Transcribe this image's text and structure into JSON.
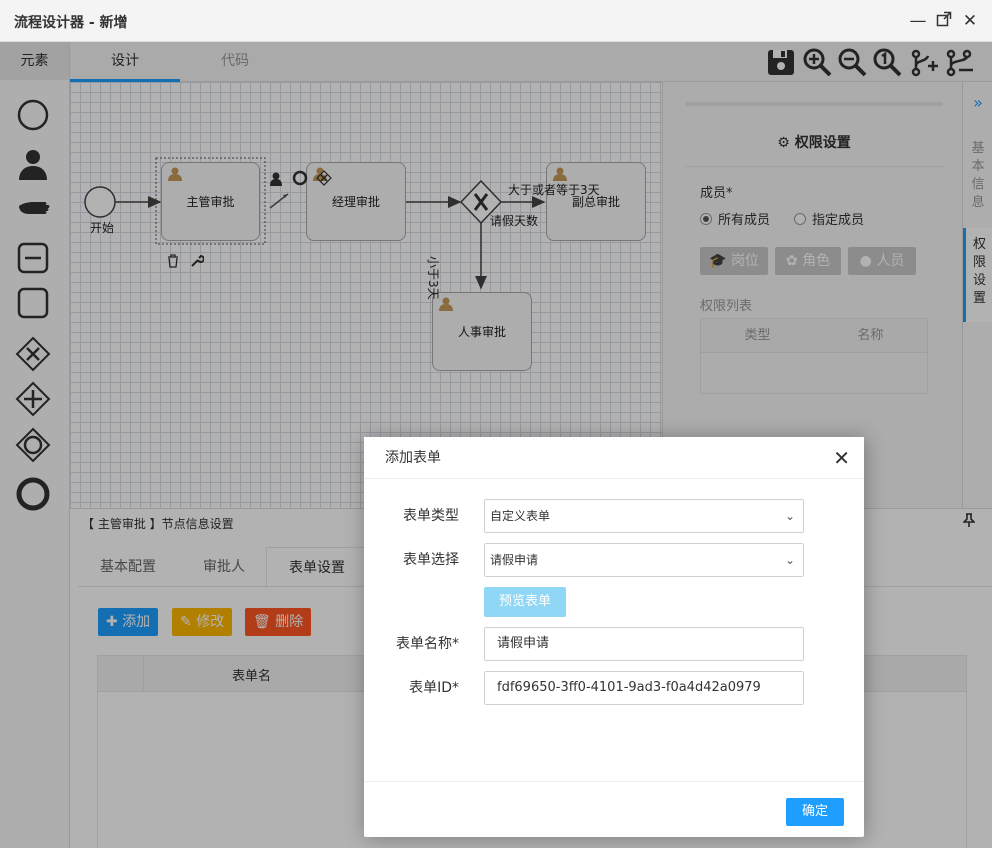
{
  "window": {
    "title": "流程设计器 - 新增",
    "minimize_icon": "minimize-icon",
    "maximize_icon": "maximize-icon",
    "close_icon": "close-icon"
  },
  "left_panel": {
    "title": "元素",
    "tools": [
      "start-event-icon",
      "user-task-icon",
      "manual-task-icon",
      "subprocess-collapsed-icon",
      "task-icon",
      "exclusive-gateway-icon",
      "parallel-gateway-icon",
      "inclusive-gateway-icon",
      "end-event-icon"
    ]
  },
  "tabs": [
    {
      "label": "设计",
      "active": true
    },
    {
      "label": "代码",
      "active": false
    }
  ],
  "toolbar_icons": [
    "save-icon",
    "zoom-in-icon",
    "zoom-out-icon",
    "actual-size-icon",
    "add-branch-icon",
    "branch-icon"
  ],
  "diagram": {
    "start_label": "开始",
    "nodes": {
      "supervisor": "主管审批",
      "manager": "经理审批",
      "vp": "副总审批",
      "hr": "人事审批"
    },
    "labels": {
      "gt3": "大于或者等于3天",
      "leave_days": "请假天数",
      "lt3": "小于3天"
    }
  },
  "right_panel": {
    "title": "权限设置",
    "members_label": "成员*",
    "options": [
      {
        "label": "所有成员",
        "selected": true
      },
      {
        "label": "指定成员",
        "selected": false
      }
    ],
    "buttons": [
      "岗位",
      "角色",
      "人员"
    ],
    "list_title": "权限列表",
    "columns": [
      "类型",
      "名称"
    ]
  },
  "right_strip": {
    "expand_icon": "double-chevron-right-icon",
    "tabs": [
      {
        "label": "基本信息",
        "active": false
      },
      {
        "label": "权限设置",
        "active": true
      }
    ]
  },
  "bottom_panel": {
    "title": "【 主管审批 】节点信息设置",
    "tabs": [
      {
        "label": "基本配置",
        "active": false
      },
      {
        "label": "审批人",
        "active": false
      },
      {
        "label": "表单设置",
        "active": true
      }
    ],
    "actions": {
      "add": "添加",
      "edit": "修改",
      "delete": "删除"
    },
    "table_columns": [
      "表单名"
    ]
  },
  "dialog": {
    "title": "添加表单",
    "fields": {
      "type_label": "表单类型",
      "type_value": "自定义表单",
      "select_label": "表单选择",
      "select_value": "请假申请",
      "preview_button": "预览表单",
      "name_label": "表单名称*",
      "name_value": "请假申请",
      "id_label": "表单ID*",
      "id_value": "fdf69650-3ff0-4101-9ad3-f0a4d42a0979"
    },
    "confirm_button": "确定"
  },
  "colors": {
    "accent": "#1e9fff",
    "add": "#1e9fff",
    "edit": "#ffb800",
    "delete": "#ff5722",
    "user_icon": "#c49a5a"
  }
}
